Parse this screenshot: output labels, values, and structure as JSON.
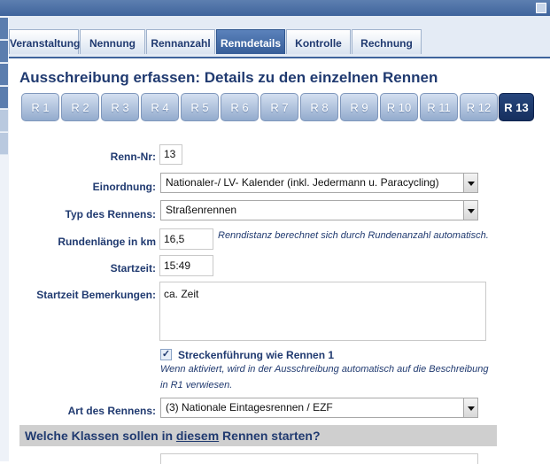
{
  "tabs": [
    {
      "label": "Veranstaltung"
    },
    {
      "label": "Nennung"
    },
    {
      "label": "Rennanzahl"
    },
    {
      "label": "Renndetails"
    },
    {
      "label": "Kontrolle"
    },
    {
      "label": "Rechnung"
    }
  ],
  "page_title": "Ausschreibung erfassen: Details zu den einzelnen Rennen",
  "race_buttons": [
    "R 1",
    "R 2",
    "R 3",
    "R 4",
    "R 5",
    "R 6",
    "R 7",
    "R 8",
    "R 9",
    "R 10",
    "R 11",
    "R 12",
    "R 13"
  ],
  "active_race": "R 13",
  "form": {
    "renn_nr": {
      "label": "Renn-Nr:",
      "value": "13"
    },
    "einordnung": {
      "label": "Einordnung:",
      "value": "Nationaler-/ LV- Kalender (inkl. Jedermann u. Paracycling)"
    },
    "typ": {
      "label": "Typ des Rennens:",
      "value": "Straßenrennen"
    },
    "rundenlaenge": {
      "label": "Rundenlänge in km",
      "value": "16,5",
      "hint": "Renndistanz berechnet sich durch Rundenanzahl automatisch."
    },
    "startzeit": {
      "label": "Startzeit:",
      "value": "15:49"
    },
    "bemerkungen": {
      "label": "Startzeit Bemerkungen:",
      "value": "ca. Zeit"
    },
    "strecke": {
      "label": "Streckenführung wie Rennen 1",
      "checked": true,
      "hint_line1": "Wenn aktiviert, wird in der Ausschreibung automatisch auf die Beschreibung",
      "hint_line2": "in R1 verwiesen."
    },
    "art": {
      "label": "Art des Rennens:",
      "value": "(3) Nationale Eintagesrennen / EZF"
    }
  },
  "section": {
    "prefix": "Welche Klassen sollen in ",
    "emph": "diesem",
    "suffix": " Rennen starten?"
  },
  "colors": {
    "accent": "#203a70",
    "tab_active": "#3f649c",
    "race_active": "#1e3a6e"
  }
}
